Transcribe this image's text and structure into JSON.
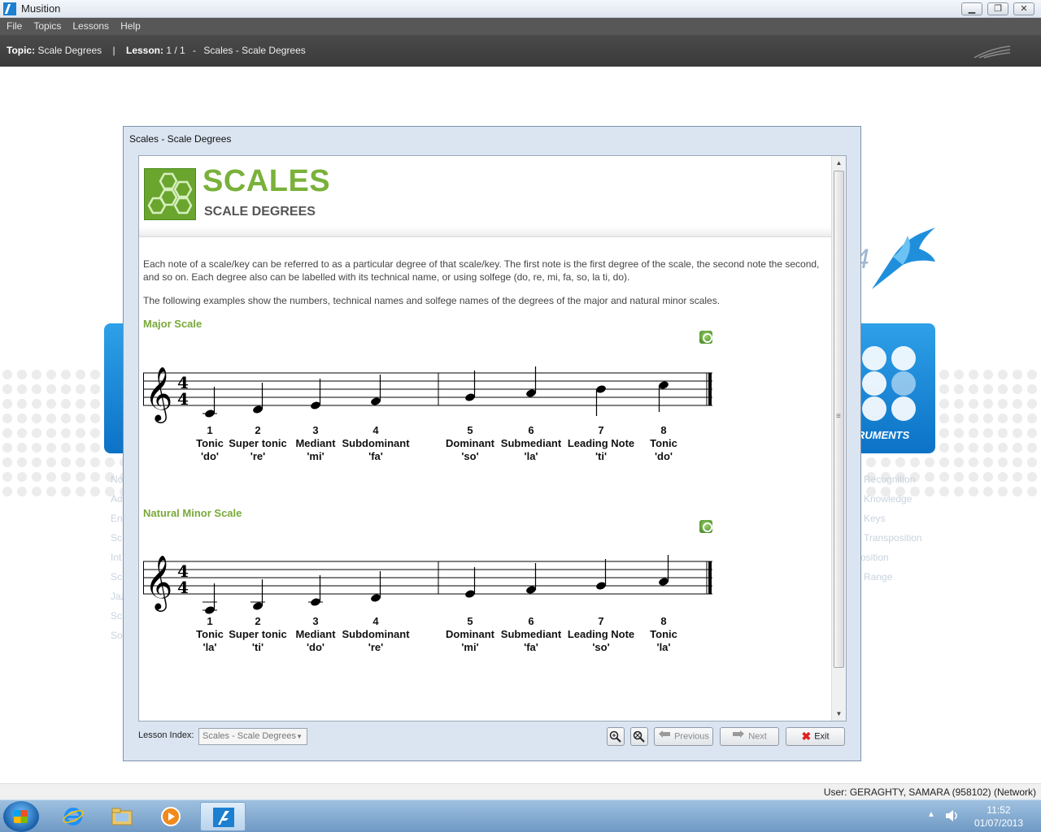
{
  "window": {
    "title": "Musition"
  },
  "menu": [
    "File",
    "Topics",
    "Lessons",
    "Help"
  ],
  "topic_bar": {
    "topic_label": "Topic:",
    "topic_value": "Scale Degrees",
    "lesson_label": "Lesson:",
    "lesson_value": "1 / 1",
    "dash": "-",
    "lesson_title": "Scales - Scale Degrees"
  },
  "background": {
    "instruments_label": "RUMENTS",
    "right_list": [
      "Recognition",
      "Knowledge",
      "Keys",
      "Transposition",
      "osition",
      "Range"
    ],
    "left_list": [
      "No",
      "Ad",
      "En",
      "Sc",
      "Int",
      "Sc",
      "Jaz",
      "Sc",
      "So"
    ]
  },
  "dialog": {
    "title": "Scales - Scale Degrees",
    "heading": "SCALES",
    "subheading": "SCALE DEGREES",
    "paragraph1": "Each note of a scale/key can be referred to as a particular degree of that scale/key. The first note is the first degree of the scale, the second note the second, and so on. Each degree also can be labelled with its technical name, or using solfege (do, re, mi, fa, so, la ti, do).",
    "paragraph2": "The following examples show the numbers, technical names and solfege names of the degrees of the major and natural minor scales.",
    "major": {
      "title": "Major Scale",
      "time_signature": "4/4",
      "degrees": [
        {
          "num": "1",
          "name": "Tonic",
          "solfege": "'do'"
        },
        {
          "num": "2",
          "name": "Super tonic",
          "solfege": "'re'"
        },
        {
          "num": "3",
          "name": "Mediant",
          "solfege": "'mi'"
        },
        {
          "num": "4",
          "name": "Subdominant",
          "solfege": "'fa'"
        },
        {
          "num": "5",
          "name": "Dominant",
          "solfege": "'so'"
        },
        {
          "num": "6",
          "name": "Submediant",
          "solfege": "'la'"
        },
        {
          "num": "7",
          "name": "Leading Note",
          "solfege": "'ti'"
        },
        {
          "num": "8",
          "name": "Tonic",
          "solfege": "'do'"
        }
      ]
    },
    "minor": {
      "title": "Natural Minor Scale",
      "time_signature": "4/4",
      "degrees": [
        {
          "num": "1",
          "name": "Tonic",
          "solfege": "'la'"
        },
        {
          "num": "2",
          "name": "Super tonic",
          "solfege": "'ti'"
        },
        {
          "num": "3",
          "name": "Mediant",
          "solfege": "'do'"
        },
        {
          "num": "4",
          "name": "Subdominant",
          "solfege": "'re'"
        },
        {
          "num": "5",
          "name": "Dominant",
          "solfege": "'mi'"
        },
        {
          "num": "6",
          "name": "Submediant",
          "solfege": "'fa'"
        },
        {
          "num": "7",
          "name": "Leading Note",
          "solfege": "'so'"
        },
        {
          "num": "8",
          "name": "Tonic",
          "solfege": "'la'"
        }
      ]
    },
    "lesson_index_label": "Lesson Index:",
    "lesson_index_value": "Scales - Scale Degrees",
    "buttons": {
      "previous": "Previous",
      "next": "Next",
      "exit": "Exit"
    }
  },
  "status": {
    "user": "User: GERAGHTY, SAMARA (958102) (Network)"
  },
  "taskbar": {
    "time": "11:52",
    "date": "01/07/2013"
  },
  "colors": {
    "accent_green": "#79b13a",
    "brand_blue": "#0c72c6"
  }
}
